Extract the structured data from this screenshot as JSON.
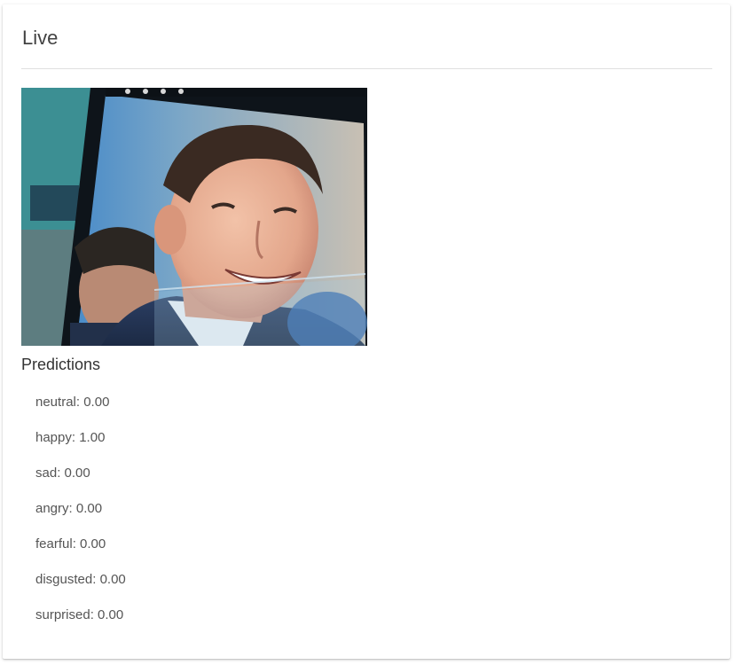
{
  "card": {
    "title": "Live"
  },
  "camera": {
    "description_icon": "video-feed"
  },
  "predictions": {
    "title": "Predictions",
    "items": [
      {
        "label": "neutral",
        "value": "0.00"
      },
      {
        "label": "happy",
        "value": "1.00"
      },
      {
        "label": "sad",
        "value": "0.00"
      },
      {
        "label": "angry",
        "value": "0.00"
      },
      {
        "label": "fearful",
        "value": "0.00"
      },
      {
        "label": "disgusted",
        "value": "0.00"
      },
      {
        "label": "surprised",
        "value": "0.00"
      }
    ]
  },
  "colors": {
    "title": "#424242",
    "text": "#555555",
    "divider": "#e0e0e0"
  }
}
